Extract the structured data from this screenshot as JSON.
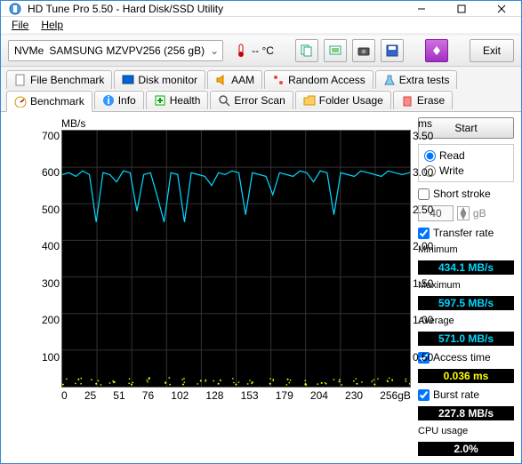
{
  "window": {
    "title": "HD Tune Pro 5.50 - Hard Disk/SSD Utility"
  },
  "menu": {
    "file": "File",
    "help": "Help"
  },
  "toolbar": {
    "drive_prefix": "NVMe",
    "drive_name": "SAMSUNG MZVPV256 (256 gB)",
    "temp": "-- °C",
    "exit": "Exit"
  },
  "tabs": {
    "file_benchmark": "File Benchmark",
    "disk_monitor": "Disk monitor",
    "aam": "AAM",
    "random_access": "Random Access",
    "extra_tests": "Extra tests",
    "benchmark": "Benchmark",
    "info": "Info",
    "health": "Health",
    "error_scan": "Error Scan",
    "folder_usage": "Folder Usage",
    "erase": "Erase"
  },
  "chart": {
    "left_unit": "MB/s",
    "right_unit": "ms",
    "x_unit": "gB",
    "y_left": [
      "700",
      "600",
      "500",
      "400",
      "300",
      "200",
      "100",
      ""
    ],
    "y_right": [
      "3.50",
      "3.00",
      "2.50",
      "2.00",
      "1.50",
      "1.00",
      "0.50",
      ""
    ],
    "x_ticks": [
      "0",
      "25",
      "51",
      "76",
      "102",
      "128",
      "153",
      "179",
      "204",
      "230",
      "256gB"
    ]
  },
  "side": {
    "start": "Start",
    "read": "Read",
    "write": "Write",
    "short_stroke": "Short stroke",
    "stroke_val": "40",
    "stroke_unit": "gB",
    "transfer_rate": "Transfer rate",
    "minimum": "Minimum",
    "min_val": "434.1 MB/s",
    "maximum": "Maximum",
    "max_val": "597.5 MB/s",
    "average": "Average",
    "avg_val": "571.0 MB/s",
    "access_time": "Access time",
    "access_val": "0.036 ms",
    "burst_rate": "Burst rate",
    "burst_val": "227.8 MB/s",
    "cpu_usage": "CPU usage",
    "cpu_val": "2.0%"
  },
  "chart_data": {
    "type": "line",
    "title": "",
    "xlabel": "gB",
    "ylabel": "MB/s",
    "xlim": [
      0,
      256
    ],
    "ylim": [
      0,
      700
    ],
    "ylim2": [
      0,
      3.5
    ],
    "series": [
      {
        "name": "Transfer rate (MB/s)",
        "color": "#00d8ff",
        "x": [
          0,
          5,
          10,
          15,
          20,
          25,
          30,
          35,
          40,
          45,
          50,
          55,
          60,
          65,
          70,
          75,
          80,
          85,
          90,
          95,
          100,
          105,
          110,
          115,
          120,
          125,
          130,
          135,
          140,
          145,
          150,
          155,
          160,
          165,
          170,
          175,
          180,
          185,
          190,
          195,
          200,
          205,
          210,
          215,
          220,
          225,
          230,
          235,
          240,
          245,
          250,
          256
        ],
        "values": [
          580,
          585,
          575,
          590,
          580,
          450,
          585,
          580,
          560,
          590,
          585,
          480,
          580,
          585,
          520,
          450,
          585,
          580,
          450,
          585,
          580,
          575,
          550,
          585,
          580,
          590,
          585,
          470,
          585,
          580,
          575,
          525,
          585,
          580,
          575,
          590,
          585,
          560,
          590,
          585,
          470,
          585,
          580,
          575,
          590,
          585,
          580,
          575,
          590,
          585,
          580,
          585
        ]
      },
      {
        "name": "Access time (ms)",
        "color": "#ffff00",
        "axis": "right",
        "x": [
          0,
          12,
          25,
          38,
          51,
          64,
          76,
          89,
          102,
          115,
          128,
          140,
          153,
          166,
          179,
          191,
          204,
          217,
          230,
          243,
          256
        ],
        "values": [
          0.03,
          0.1,
          0.04,
          0.06,
          0.03,
          0.12,
          0.05,
          0.03,
          0.08,
          0.04,
          0.03,
          0.06,
          0.04,
          0.1,
          0.03,
          0.05,
          0.07,
          0.04,
          0.03,
          0.09,
          0.04
        ]
      }
    ]
  }
}
